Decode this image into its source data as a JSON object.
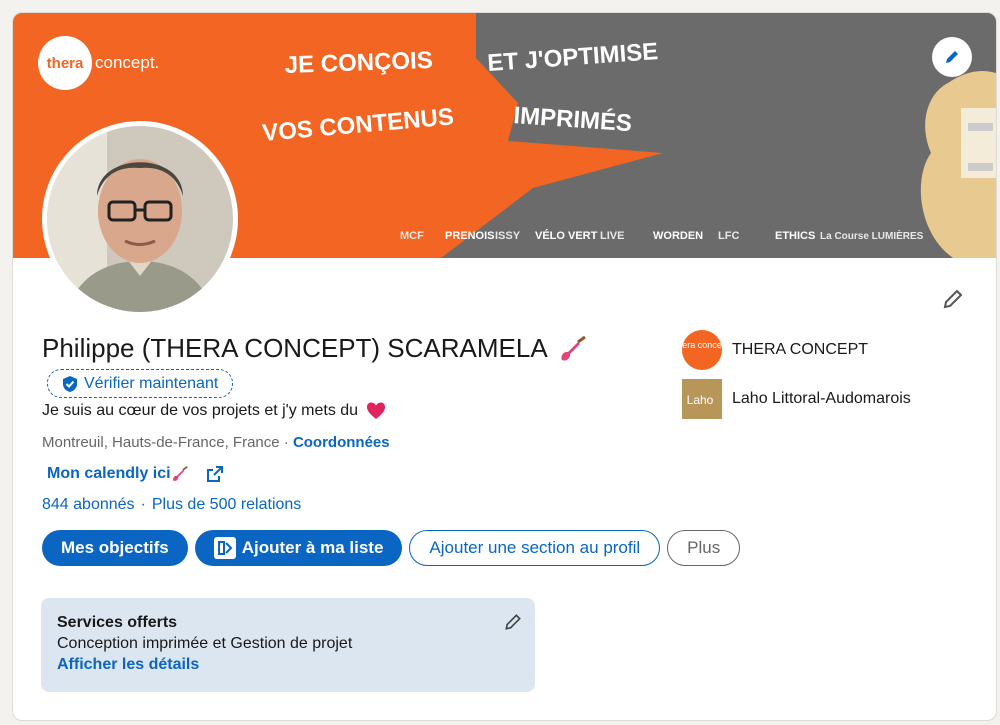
{
  "banner": {
    "logo_text_left": "thera",
    "logo_text_right": "concept.",
    "line1_part1": "JE CONÇOIS",
    "line1_part2": "ET J'OPTIMISE",
    "line2_part1": "VOS CONTENUS",
    "line2_part2": "IMPRIMÉS",
    "partner_logos": [
      "MCF",
      "PRENOIS",
      "ISSY",
      "VÉLO VERT",
      "LIVE",
      "WORDEN",
      "LFC",
      "ETHICS",
      "La Course LUMIÈRES"
    ],
    "colors": {
      "orange": "#f26522",
      "grey": "#6e6e6e"
    }
  },
  "profile": {
    "name": "Philippe (THERA CONCEPT) SCARAMELA",
    "verify_label": "Vérifier maintenant",
    "headline": "Je suis au cœur de vos projets et j'y mets du",
    "location": "Montreuil, Hauts-de-France, France",
    "contact_label": "Coordonnées",
    "calendly_label": "Mon calendly ici",
    "followers": "844 abonnés",
    "connections": "Plus de 500 relations"
  },
  "actions": {
    "goals": "Mes objectifs",
    "add_list": "Ajouter à ma liste",
    "add_section": "Ajouter une section au profil",
    "more": "Plus"
  },
  "companies": [
    {
      "name": "THERA CONCEPT",
      "logo_text": "thera concept"
    },
    {
      "name": "Laho Littoral-Audomarois",
      "logo_text": "Laho"
    }
  ],
  "services": {
    "title": "Services offerts",
    "description": "Conception imprimée et Gestion de projet",
    "link": "Afficher les détails"
  },
  "icons": [
    "pencil-icon",
    "shield-check-icon",
    "guitar-emoji-icon",
    "heart-emoji-icon",
    "external-link-icon",
    "list-icon"
  ]
}
